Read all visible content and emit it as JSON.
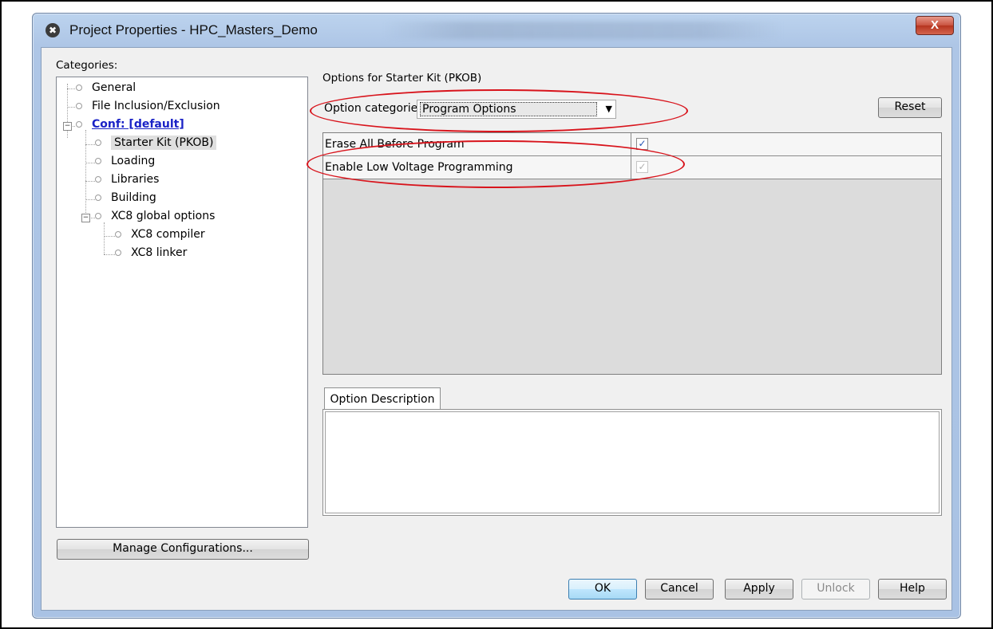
{
  "window": {
    "title": "Project Properties - HPC_Masters_Demo",
    "close_label": "X",
    "app_icon": "app-icon",
    "accent_color": "#d8141c"
  },
  "categories": {
    "label": "Categories:",
    "items": [
      {
        "label": "General",
        "level": 1
      },
      {
        "label": "File Inclusion/Exclusion",
        "level": 1
      },
      {
        "label": "Conf: [default]",
        "level": 1,
        "expanded": true
      },
      {
        "label": "Starter Kit (PKOB)",
        "level": 2,
        "selected": true
      },
      {
        "label": "Loading",
        "level": 2
      },
      {
        "label": "Libraries",
        "level": 2
      },
      {
        "label": "Building",
        "level": 2
      },
      {
        "label": "XC8 global options",
        "level": 2,
        "expanded": true
      },
      {
        "label": "XC8 compiler",
        "level": 3
      },
      {
        "label": "XC8 linker",
        "level": 3
      }
    ],
    "manage_button": "Manage Configurations..."
  },
  "options": {
    "heading": "Options for Starter Kit (PKOB)",
    "category_label": "Option categories:",
    "category_value": "Program Options",
    "reset_button": "Reset",
    "rows": [
      {
        "label": "Erase All Before Program",
        "checked": true,
        "enabled": true
      },
      {
        "label": "Enable Low Voltage Programming",
        "checked": true,
        "enabled": false
      }
    ],
    "description_tab": "Option Description",
    "description_text": ""
  },
  "buttons": {
    "ok": "OK",
    "cancel": "Cancel",
    "apply": "Apply",
    "unlock": "Unlock",
    "help": "Help"
  }
}
